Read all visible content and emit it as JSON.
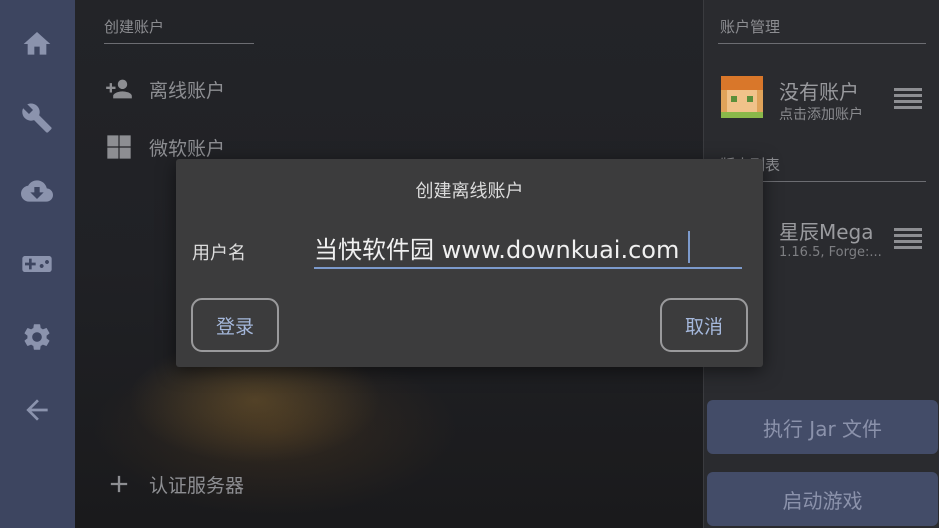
{
  "nav": {
    "items": [
      {
        "icon": "home-icon"
      },
      {
        "icon": "wrench-icon"
      },
      {
        "icon": "cloud-download-icon"
      },
      {
        "icon": "gamepad-icon"
      },
      {
        "icon": "gear-icon"
      },
      {
        "icon": "back-arrow-icon"
      }
    ]
  },
  "create_account": {
    "heading": "创建账户",
    "offline_label": "离线账户",
    "microsoft_label": "微软账户",
    "auth_server_label": "认证服务器"
  },
  "account_manage": {
    "heading": "账户管理",
    "no_account": "没有账户",
    "no_account_hint": "点击添加账户"
  },
  "versions": {
    "heading": "版本列表",
    "name": "星辰Mega",
    "detail": "1.16.5, Forge:..."
  },
  "actions": {
    "run_jar": "执行 Jar 文件",
    "launch": "启动游戏"
  },
  "dialog": {
    "title": "创建离线账户",
    "username_label": "用户名",
    "username_value": "当快软件园 www.downkuai.com",
    "login_button": "登录",
    "cancel_button": "取消"
  },
  "colors": {
    "rail": "#3d4560",
    "accent": "#7c9acc",
    "dialog_bg": "#3c3c3d"
  }
}
